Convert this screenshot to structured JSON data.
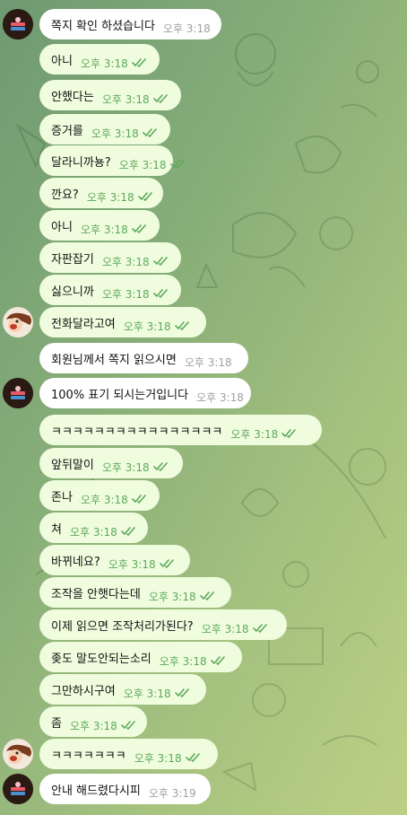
{
  "chat": {
    "messages": [
      {
        "text": "쪽지 확인 하셨습니다",
        "time": "오후 3:18",
        "dir": "in",
        "read": false
      },
      {
        "text": "아니",
        "time": "오후 3:18",
        "dir": "out",
        "read": true
      },
      {
        "text": "안했다는",
        "time": "오후 3:18",
        "dir": "out",
        "read": true
      },
      {
        "text": "증거를",
        "time": "오후 3:18",
        "dir": "out",
        "read": true
      },
      {
        "text": "달라니까뇽?",
        "time": "오후 3:18",
        "dir": "out",
        "read": true
      },
      {
        "text": "깐요?",
        "time": "오후 3:18",
        "dir": "out",
        "read": true
      },
      {
        "text": "아니",
        "time": "오후 3:18",
        "dir": "out",
        "read": true
      },
      {
        "text": "자판잡기",
        "time": "오후 3:18",
        "dir": "out",
        "read": true
      },
      {
        "text": "싫으니까",
        "time": "오후 3:18",
        "dir": "out",
        "read": true
      },
      {
        "text": "전화달라고여",
        "time": "오후 3:18",
        "dir": "out",
        "read": true
      },
      {
        "text": "회원님께서 쪽지 읽으시면",
        "time": "오후 3:18",
        "dir": "in",
        "read": false
      },
      {
        "text": "100% 표기 되시는거입니다",
        "time": "오후 3:18",
        "dir": "in",
        "read": false
      },
      {
        "text": "ㅋㅋㅋㅋㅋㅋㅋㅋㅋㅋㅋㅋㅋㅋㅋㅋ",
        "time": "오후 3:18",
        "dir": "out",
        "read": true
      },
      {
        "text": "앞뒤말이",
        "time": "오후 3:18",
        "dir": "out",
        "read": true
      },
      {
        "text": "존나",
        "time": "오후 3:18",
        "dir": "out",
        "read": true
      },
      {
        "text": "쳐",
        "time": "오후 3:18",
        "dir": "out",
        "read": true
      },
      {
        "text": "바뀌네요?",
        "time": "오후 3:18",
        "dir": "out",
        "read": true
      },
      {
        "text": "조작을 안햇다는데",
        "time": "오후 3:18",
        "dir": "out",
        "read": true
      },
      {
        "text": "이제 읽으면 조작처리가된다?",
        "time": "오후 3:18",
        "dir": "out",
        "read": true
      },
      {
        "text": "좆도 말도안되는소리",
        "time": "오후 3:18",
        "dir": "out",
        "read": true
      },
      {
        "text": "그만하시구여",
        "time": "오후 3:18",
        "dir": "out",
        "read": true
      },
      {
        "text": "좀",
        "time": "오후 3:18",
        "dir": "out",
        "read": true
      },
      {
        "text": "ㅋㅋㅋㅋㅋㅋㅋ",
        "time": "오후 3:18",
        "dir": "out",
        "read": true
      },
      {
        "text": "안내 해드렸다시피",
        "time": "오후 3:19",
        "dir": "in",
        "read": false
      }
    ],
    "avatars": [
      {
        "kind": "agent",
        "name": "agent-avatar"
      },
      {
        "kind": "user",
        "name": "user-avatar"
      },
      {
        "kind": "agent",
        "name": "agent-avatar"
      },
      {
        "kind": "user",
        "name": "user-avatar"
      },
      {
        "kind": "agent",
        "name": "agent-avatar"
      }
    ]
  },
  "colors": {
    "incoming_bubble": "#ffffff",
    "outgoing_bubble": "#effdde",
    "read_check": "#5fa85e",
    "timestamp_in": "#a0a0a0"
  }
}
